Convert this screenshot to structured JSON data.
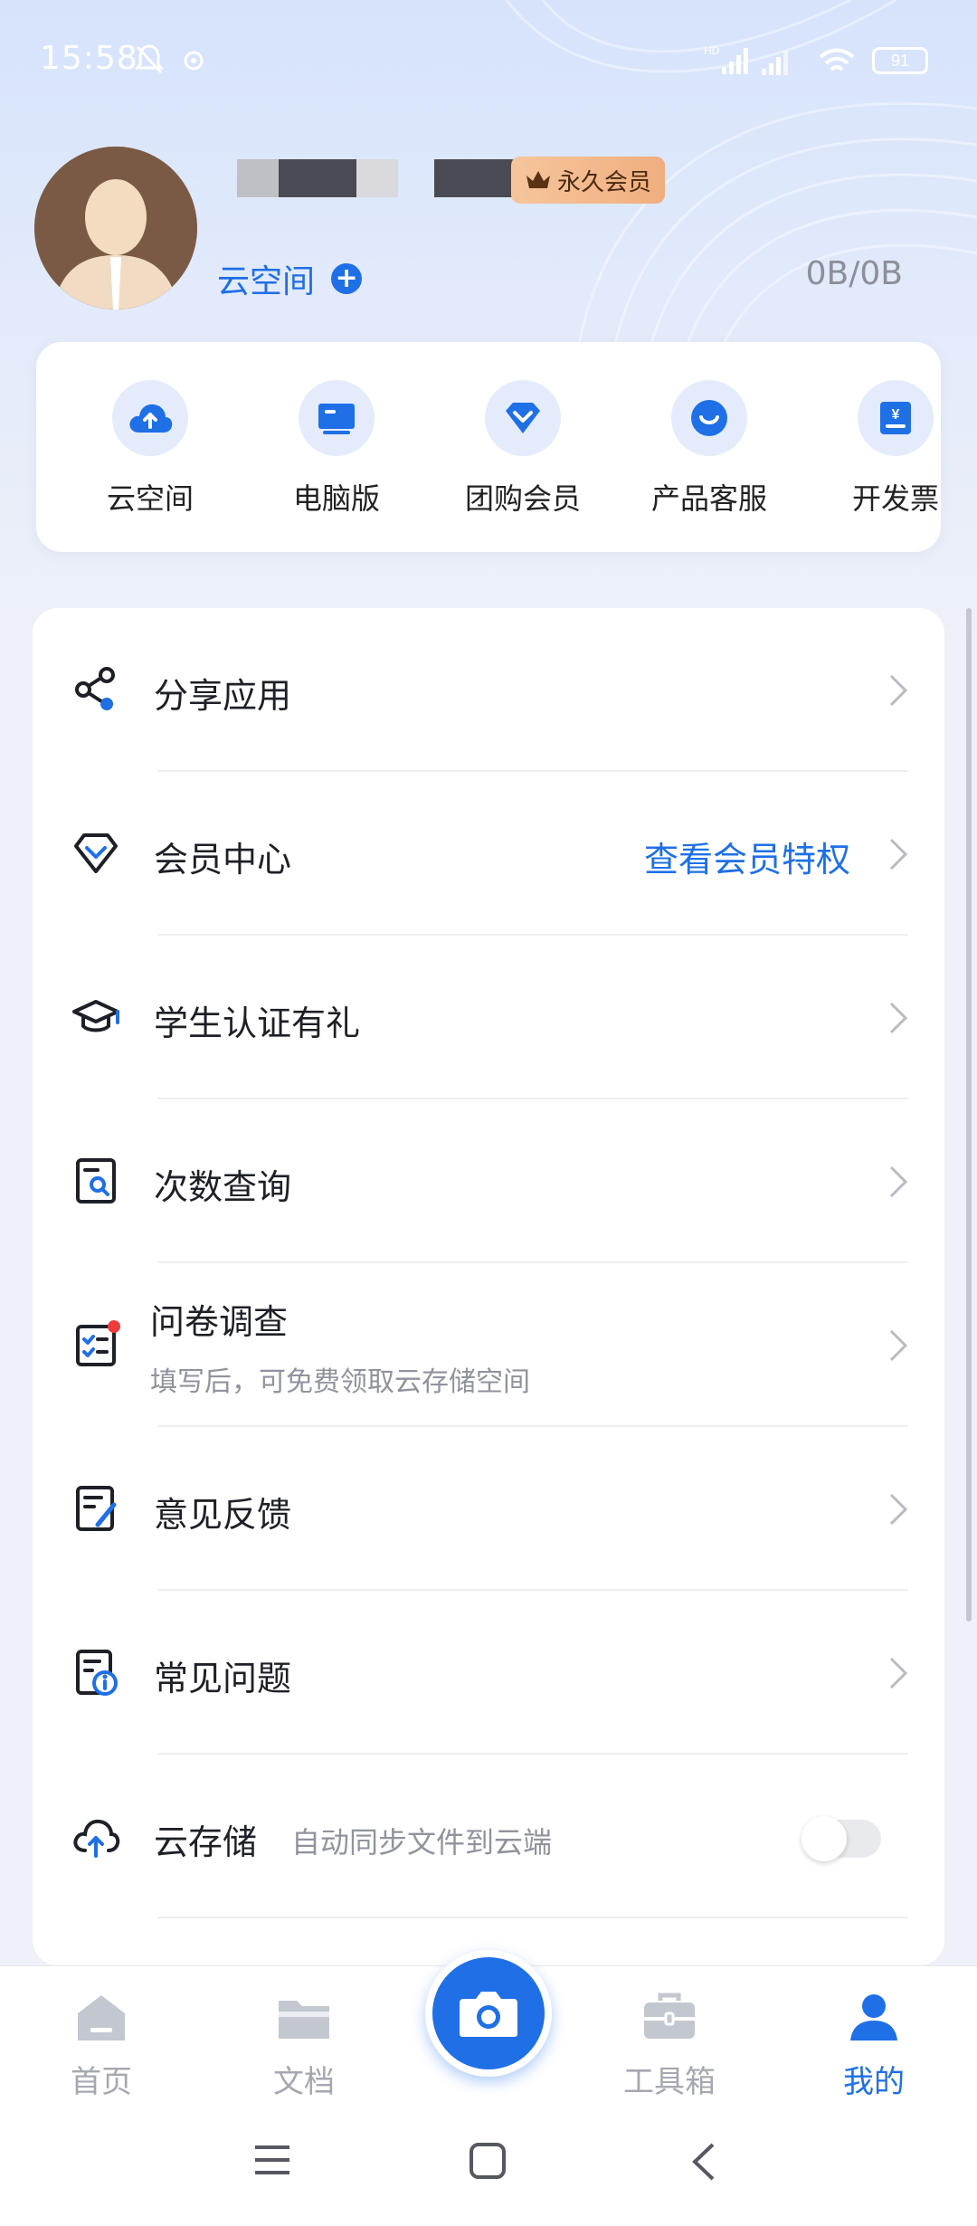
{
  "status_bar": {
    "time": "15:58",
    "battery": "91",
    "icons": [
      "mute-bell-icon",
      "app-notification-icon",
      "hd-signal-icon",
      "signal-icon",
      "wifi-icon",
      "battery-icon"
    ]
  },
  "profile": {
    "avatar_icon": "person-avatar-icon",
    "member_badge": "永久会员",
    "space_label": "云空间",
    "usage": "0B/0B"
  },
  "quick_actions": [
    {
      "label": "云空间",
      "icon": "cloud-upload-icon"
    },
    {
      "label": "电脑版",
      "icon": "monitor-icon"
    },
    {
      "label": "团购会员",
      "icon": "diamond-icon"
    },
    {
      "label": "产品客服",
      "icon": "service-chat-icon"
    },
    {
      "label": "开发票",
      "icon": "invoice-icon"
    }
  ],
  "menu": {
    "share": {
      "title": "分享应用",
      "icon": "share-icon"
    },
    "vip": {
      "title": "会员中心",
      "extra": "查看会员特权",
      "icon": "diamond-outline-icon"
    },
    "student": {
      "title": "学生认证有礼",
      "icon": "graduation-cap-icon"
    },
    "count": {
      "title": "次数查询",
      "icon": "search-document-icon"
    },
    "survey": {
      "title": "问卷调查",
      "subtitle": "填写后，可免费领取云存储空间",
      "icon": "checklist-icon"
    },
    "feedback": {
      "title": "意见反馈",
      "icon": "edit-document-icon"
    },
    "faq": {
      "title": "常见问题",
      "icon": "info-document-icon"
    },
    "cloud": {
      "title": "云存储",
      "subtitle": "自动同步文件到云端",
      "icon": "cloud-upload-outline-icon",
      "toggle_on": false
    }
  },
  "bottom_nav": {
    "home": "首页",
    "docs": "文档",
    "tools": "工具箱",
    "mine": "我的",
    "camera_icon": "camera-icon",
    "active": "mine"
  },
  "colors": {
    "accent": "#1f6fe6",
    "badge": "#f3b88a",
    "inactive": "#a5a8b1"
  }
}
